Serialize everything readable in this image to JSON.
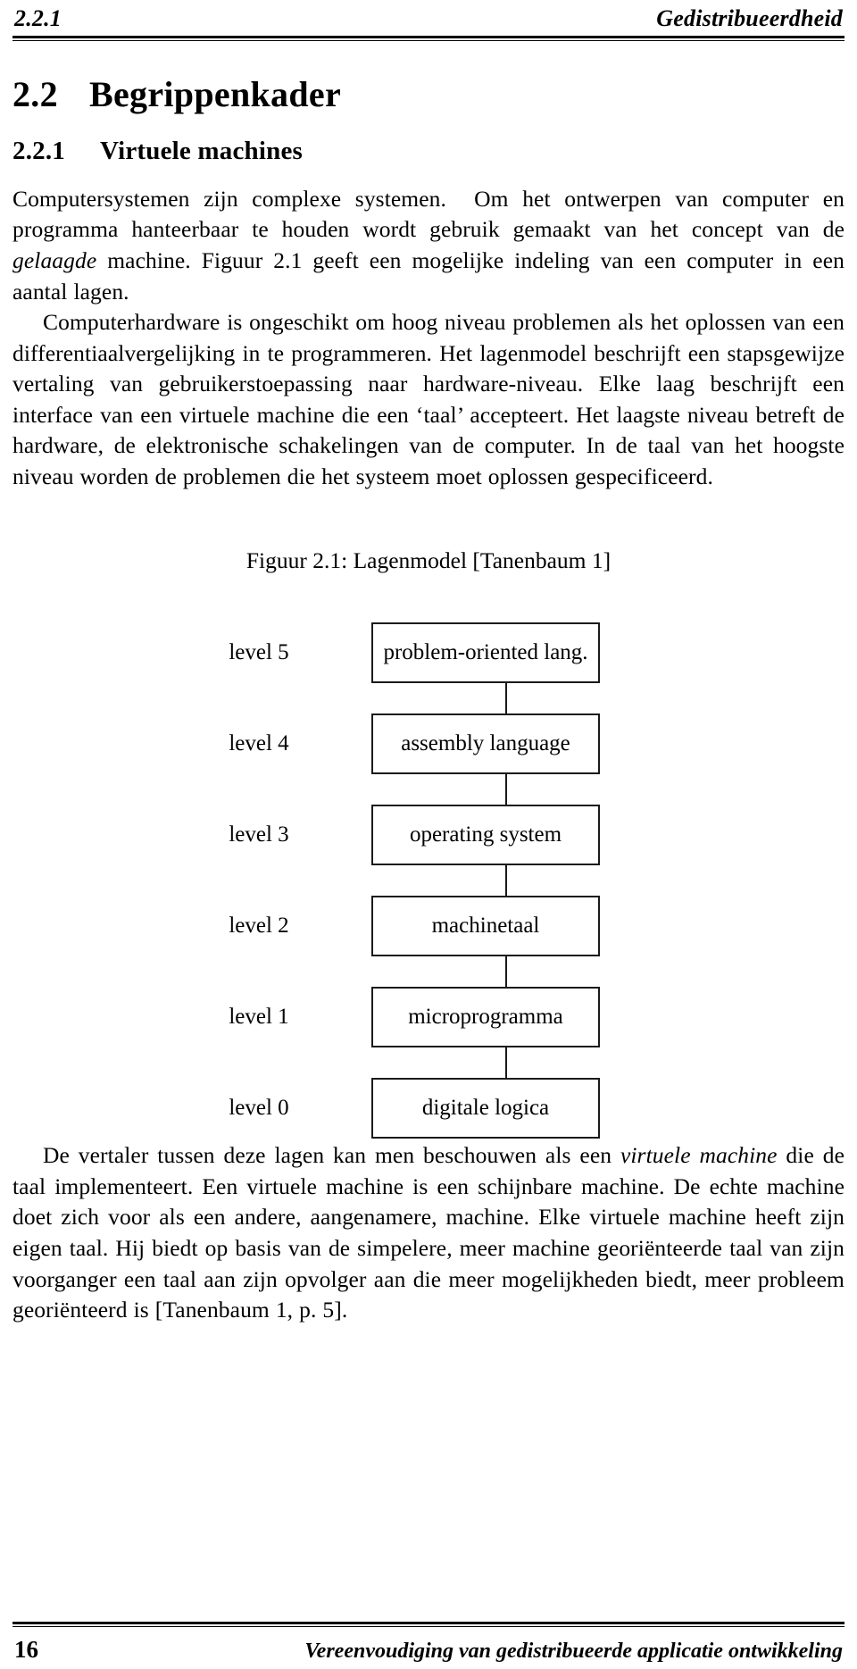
{
  "running_head": {
    "left": "2.2.1",
    "right": "Gedistribueerdheid"
  },
  "section": {
    "number": "2.2",
    "title": "Begrippenkader"
  },
  "subsection": {
    "number": "2.2.1",
    "title": "Virtuele machines"
  },
  "paragraphs": {
    "p1_a": "Computersystemen zijn complexe systemen.",
    "p1_b": "Om het ontwerpen van computer en programma hanteerbaar te houden wordt gebruik gemaakt van het concept van de ",
    "p1_italic": "gelaagde",
    "p1_c": " machine. Figuur 2.1 geeft een mogelijke indeling van een computer in een aantal lagen.",
    "p2": "Computerhardware is ongeschikt om hoog niveau problemen als het oplossen van een differentiaalvergelijking in te programmeren. Het lagenmodel beschrijft een stapsgewijze vertaling van gebruikerstoepassing naar hardware-niveau. Elke laag beschrijft een interface van een virtuele machine die een ‘taal’ accepteert. Het laagste niveau betreft de hardware, de elektronische schakelingen van de computer. In de taal van het hoogste niveau worden de problemen die het systeem moet oplossen gespecificeerd.",
    "p3_a": "De vertaler tussen deze lagen kan men beschouwen als een ",
    "p3_italic1": "virtuele machine",
    "p3_b": " die de taal implementeert. Een virtuele machine is een schijnbare machine. De echte machine doet zich voor als een andere, aangenamere, machine. Elke virtuele machine heeft zijn eigen taal. Hij biedt op basis van de simpelere, meer machine georiënteerde taal van zijn voorganger een taal aan zijn opvolger aan die meer mogelijkheden biedt, meer probleem georiënteerd is [Tanenbaum 1, p. 5]."
  },
  "figure": {
    "caption": "Figuur 2.1: Lagenmodel [Tanenbaum 1]",
    "levels": [
      {
        "label": "level 5",
        "box": "problem-oriented lang."
      },
      {
        "label": "level 4",
        "box": "assembly language"
      },
      {
        "label": "level 3",
        "box": "operating system"
      },
      {
        "label": "level 2",
        "box": "machinetaal"
      },
      {
        "label": "level 1",
        "box": "microprogramma"
      },
      {
        "label": "level 0",
        "box": "digitale logica"
      }
    ]
  },
  "footer": {
    "page_number": "16",
    "title": "Vereenvoudiging van gedistribueerde applicatie ontwikkeling"
  }
}
